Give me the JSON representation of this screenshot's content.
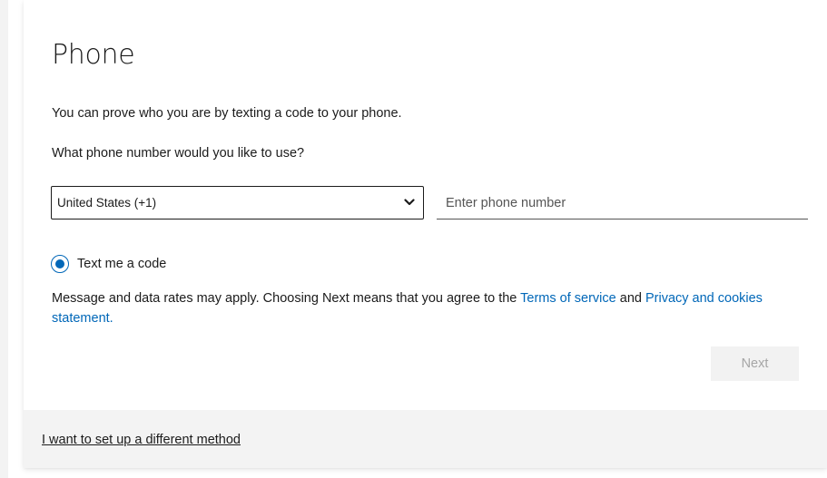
{
  "dialog": {
    "title": "Phone",
    "intro_text": "You can prove who you are by texting a code to your phone.",
    "question_text": "What phone number would you like to use?"
  },
  "country_select": {
    "selected": "United States (+1)",
    "icon": "chevron-down-icon"
  },
  "phone_input": {
    "value": "",
    "placeholder": "Enter phone number"
  },
  "method_radio": {
    "label": "Text me a code",
    "checked": true
  },
  "disclaimer": {
    "prefix": "Message and data rates may apply. Choosing Next means that you agree to the",
    "terms_link": "Terms of service",
    "and_text": "and",
    "privacy_link": "Privacy and cookies statement."
  },
  "actions": {
    "next_label": "Next",
    "next_enabled": false
  },
  "footer": {
    "alt_method_link": "I want to set up a different method"
  },
  "colors": {
    "accent": "#0067b8",
    "text": "#1b1b1b",
    "footer_bg": "#f3f3f3",
    "disabled_button_bg": "#f2f2f2",
    "disabled_button_text": "#a6a6a6"
  }
}
